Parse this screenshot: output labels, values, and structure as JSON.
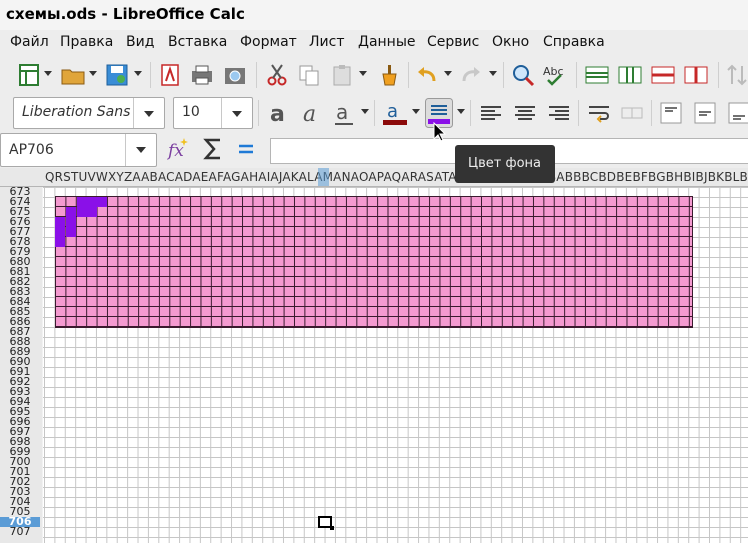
{
  "window": {
    "title": "схемы.ods - LibreOffice Calc"
  },
  "menu": [
    "Файл",
    "Правка",
    "Вид",
    "Вставка",
    "Формат",
    "Лист",
    "Данные",
    "Сервис",
    "Окно",
    "Справка"
  ],
  "toolbar2": {
    "font_name": "Liberation Sans",
    "font_size": "10"
  },
  "toolbar3": {
    "name_box": "AP706",
    "formula": ""
  },
  "tooltip": {
    "text": "Цвет фона"
  },
  "columns": "QRSTUVWXYZAABACADAEAFAGAHAIAJAKALAMANAOAPAQARASATAUAVAWAXAYAZBABBBCBDBEBFBGBHBIBJBKBLBMBNBOBPBQBRBSBTBUBVBWBXBYBZCACB",
  "rows": [
    "673",
    "674",
    "675",
    "676",
    "677",
    "678",
    "679",
    "680",
    "681",
    "682",
    "683",
    "684",
    "685",
    "686",
    "687",
    "688",
    "689",
    "690",
    "691",
    "692",
    "693",
    "694",
    "695",
    "696",
    "697",
    "698",
    "699",
    "700",
    "701",
    "702",
    "703",
    "704",
    "705",
    "706",
    "707"
  ],
  "selected_row": "706",
  "colors": {
    "fill": "#f49ad0",
    "pattern": "#8a10e8",
    "selection": "#5b9cd6"
  }
}
